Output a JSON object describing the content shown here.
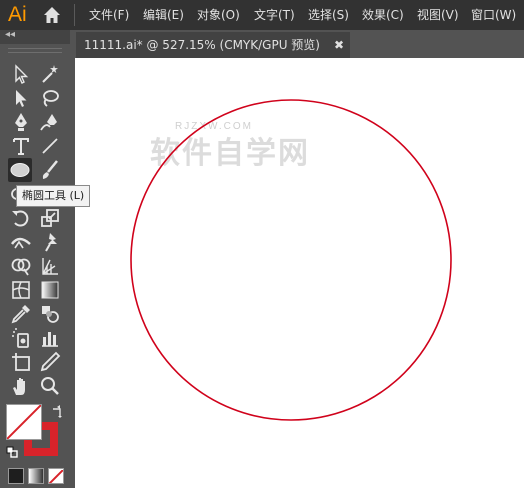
{
  "app": {
    "logo": "Ai"
  },
  "menu": [
    "文件(F)",
    "编辑(E)",
    "对象(O)",
    "文字(T)",
    "选择(S)",
    "效果(C)",
    "视图(V)",
    "窗口(W)"
  ],
  "panel": {
    "collapse": "◂◂"
  },
  "document_tab": {
    "title": "11111.ai* @ 527.15% (CMYK/GPU 预览)",
    "close": "✖"
  },
  "tooltip": {
    "text": "椭圆工具 (L)"
  },
  "watermark": {
    "main": "软件自学网",
    "sub": "RJZXW.COM"
  },
  "colors": {
    "stroke": "#d8232a",
    "circle_stroke": "#d0021b",
    "logo": "#ff9a00"
  },
  "tools": [
    [
      "selection-tool",
      "direct-selection-tool"
    ],
    [
      "magic-wand-tool",
      "lasso-tool"
    ],
    [
      "pen-tool",
      "curvature-tool"
    ],
    [
      "type-tool",
      "line-segment-tool"
    ],
    [
      "ellipse-tool",
      "paintbrush-tool"
    ],
    [
      "shaper-tool",
      "eraser-tool"
    ],
    [
      "rotate-tool",
      "scale-tool"
    ],
    [
      "width-tool",
      "puppet-warp-tool"
    ],
    [
      "shape-builder-tool",
      "perspective-grid-tool"
    ],
    [
      "mesh-tool",
      "gradient-tool"
    ],
    [
      "eyedropper-tool",
      "blend-tool"
    ],
    [
      "symbol-sprayer-tool",
      "column-graph-tool"
    ],
    [
      "artboard-tool",
      "slice-tool"
    ],
    [
      "hand-tool",
      "zoom-tool"
    ]
  ]
}
